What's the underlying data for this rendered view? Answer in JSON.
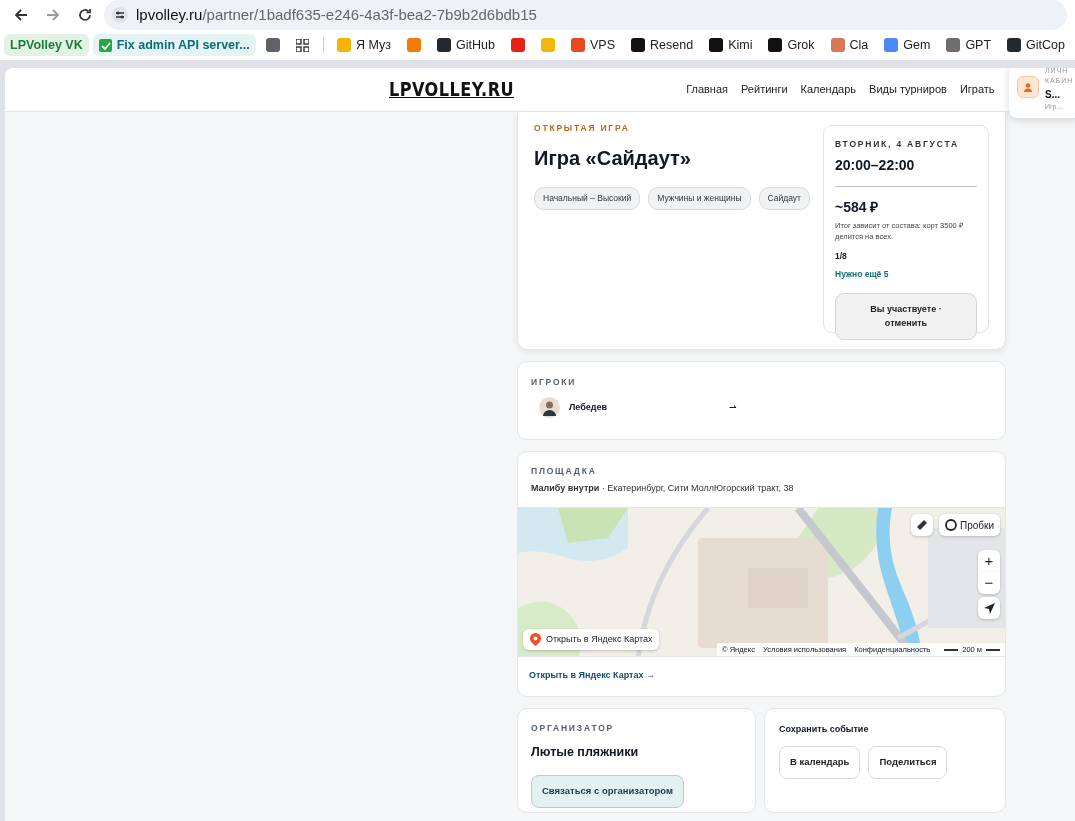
{
  "browser": {
    "url": {
      "host": "lpvolley.ru",
      "path": "/partner/1badf635-e246-4a3f-bea2-7b9b2d6bdb15"
    },
    "bookmarks": [
      {
        "kind": "chip",
        "label": "LPVolley VK",
        "color": "#1a7f37"
      },
      {
        "kind": "tab",
        "label": "Fix admin API server...",
        "color": "#22a845"
      },
      {
        "kind": "icon",
        "color": "#5f6368"
      },
      {
        "kind": "apps"
      },
      {
        "kind": "separator"
      },
      {
        "kind": "link",
        "label": "Я Муз",
        "color": "#f5b400"
      },
      {
        "kind": "icon",
        "color": "#f57c00"
      },
      {
        "kind": "link",
        "label": "GitHub",
        "color": "#24292f"
      },
      {
        "kind": "icon",
        "color": "#e62117"
      },
      {
        "kind": "icon",
        "color": "#f0b90b"
      },
      {
        "kind": "link",
        "label": "VPS",
        "color": "#e8491d"
      },
      {
        "kind": "link",
        "label": "Resend",
        "color": "#111111"
      },
      {
        "kind": "link",
        "label": "Kimi",
        "color": "#111111"
      },
      {
        "kind": "link",
        "label": "Grok",
        "color": "#111111"
      },
      {
        "kind": "link",
        "label": "Cla",
        "color": "#d97757"
      },
      {
        "kind": "link",
        "label": "Gem",
        "color": "#4a8af4"
      },
      {
        "kind": "link",
        "label": "GPT",
        "color": "#6e6e6e"
      },
      {
        "kind": "link",
        "label": "GitCop",
        "color": "#24292f"
      }
    ]
  },
  "site": {
    "logo": "LPVOLLEY.RU",
    "nav": [
      "Главная",
      "Рейтинги",
      "Календарь",
      "Виды турниров",
      "Играть"
    ],
    "profile": {
      "caption_lines": [
        "ЛИЧН",
        "КАБИН"
      ],
      "name": "S...",
      "subtitle": "Игр..."
    }
  },
  "event": {
    "kicker": "ОТКРЫТАЯ ИГРА",
    "title": "Игра «Сайдаут»",
    "tags": [
      "Начальный – Высокий",
      "Мужчины и женщины",
      "Сайдаут"
    ],
    "schedule": {
      "date": "ВТОРНИК, 4 АВГУСТА",
      "time": "20:00–22:00",
      "price": "~584 ₽",
      "price_note": "Итог зависит от состава: корт 3500 ₽ делится на всех.",
      "count": "1/8",
      "need": "Нужно ещё 5",
      "button": "Вы участвуете · отменить"
    }
  },
  "players": {
    "heading": "ИГРОКИ",
    "list": [
      {
        "name": "Лебедев",
        "marker": "⇀"
      }
    ]
  },
  "venue": {
    "heading": "ПЛОЩАДКА",
    "line": "**Малибу внутри** · Екатеринбург, Сити МоллЮгорский тракт, 38",
    "map": {
      "kind": "picture",
      "traffic_button": "Пробки",
      "zoom_in": "+",
      "zoom_out": "−",
      "open_button": "Открыть в Яндекс Картах",
      "attribution": [
        "© Яндекс",
        "Условия использования",
        "Конфиденциальность"
      ],
      "scale": "200 м"
    },
    "link": "Открыть в Яндекс Картах →"
  },
  "organizer": {
    "heading": "ОРГАНИЗАТОР",
    "name": "Лютые пляжники",
    "button": "Связаться с организатором"
  },
  "save": {
    "heading": "Сохранить событие",
    "buttons": [
      "В календарь",
      "Поделиться"
    ]
  }
}
